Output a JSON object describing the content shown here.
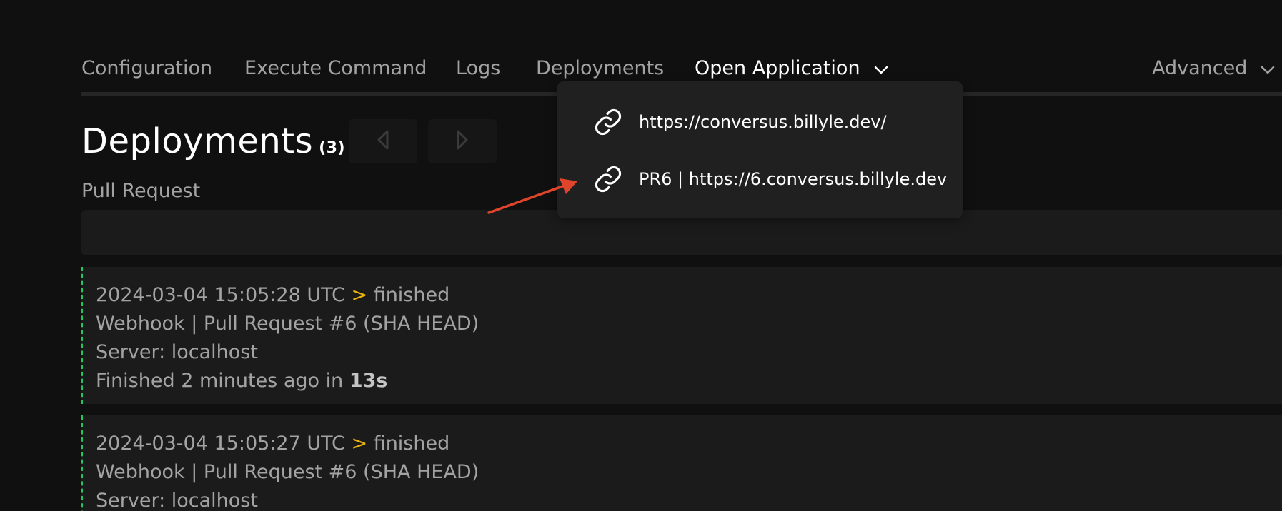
{
  "nav": {
    "items": [
      {
        "label": "Configuration"
      },
      {
        "label": "Execute Command"
      },
      {
        "label": "Logs"
      },
      {
        "label": "Deployments"
      },
      {
        "label": "Open Application"
      },
      {
        "label": "Advanced"
      }
    ],
    "active_item": "Open Application",
    "icons": {
      "dropdown": "chevron-down-icon"
    }
  },
  "page": {
    "title": "Deployments",
    "count": "(3)",
    "section_label": "Pull Request",
    "pager": {
      "prev_icon": "triangle-left-icon",
      "next_icon": "triangle-right-icon"
    }
  },
  "dropdown": {
    "items": [
      {
        "label": "https://conversus.billyle.dev/",
        "icon": "link-icon"
      },
      {
        "label": "PR6 | https://6.conversus.billyle.dev",
        "icon": "link-icon"
      }
    ]
  },
  "deployments": [
    {
      "timestamp": "2024-03-04 15:05:28 UTC",
      "separator": ">",
      "status": "finished",
      "trigger": "Webhook | Pull Request #6 (SHA HEAD)",
      "server": "Server: localhost",
      "finished_prefix": "Finished 2 minutes ago in",
      "duration": "13s"
    },
    {
      "timestamp": "2024-03-04 15:05:27 UTC",
      "separator": ">",
      "status": "finished",
      "trigger": "Webhook | Pull Request #6 (SHA HEAD)",
      "server": "Server: localhost"
    }
  ],
  "colors": {
    "background": "#101010",
    "card": "#1b1b1b",
    "accent_separator": "#eab308",
    "status_border": "#22c55e",
    "annotation_arrow": "#e0452b"
  }
}
